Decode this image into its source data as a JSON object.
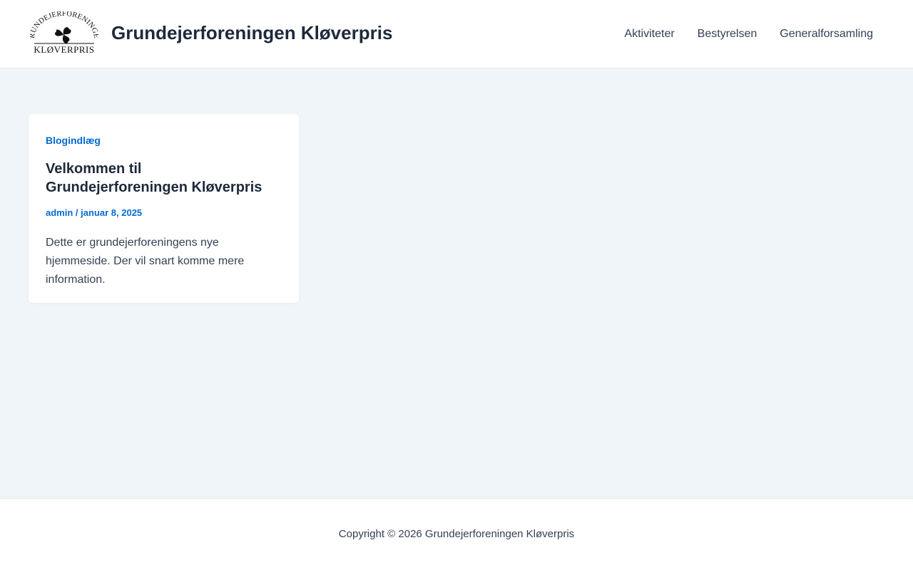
{
  "header": {
    "logo": {
      "arc_text": "GRUNDEJERFORENINGEN",
      "bottom_text": "KLØVERPRIS",
      "icon": "clover-icon"
    },
    "site_title": "Grundejerforeningen Kløverpris",
    "nav": [
      {
        "label": "Aktiviteter"
      },
      {
        "label": "Bestyrelsen"
      },
      {
        "label": "Generalforsamling"
      }
    ]
  },
  "post": {
    "category": "Blogindlæg",
    "title": "Velkommen til Grundejerforeningen Kløverpris",
    "author": "admin",
    "separator": "/",
    "date": "januar 8, 2025",
    "excerpt": "Dette er grundejerforeningens nye hjemmeside. Der vil snart komme mere information."
  },
  "footer": {
    "copyright": "Copyright © 2026 Grundejerforeningen Kløverpris"
  },
  "colors": {
    "accent": "#046bd2",
    "page_background": "#f0f5fa",
    "heading": "#1e293b"
  }
}
